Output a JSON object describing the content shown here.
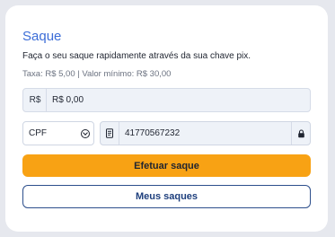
{
  "card": {
    "title": "Saque",
    "subtitle": "Faça o seu saque rapidamente através da sua chave pix.",
    "fee_info": "Taxa: R$ 5,00 | Valor mínimo: R$ 30,00"
  },
  "amount": {
    "currency_symbol": "R$",
    "value": "R$ 0,00"
  },
  "pix_key": {
    "type_selected": "CPF",
    "value": "41770567232",
    "doc_icon": "document-icon",
    "lock_icon": "lock-icon",
    "select_icon": "chevron-down-circle-icon"
  },
  "buttons": {
    "submit_label": "Efetuar saque",
    "history_label": "Meus saques"
  },
  "colors": {
    "title": "#3c6dd7",
    "primary_button": "#f8a214",
    "secondary_border": "#2d4f8c",
    "secondary_text": "#1e3f7d"
  }
}
